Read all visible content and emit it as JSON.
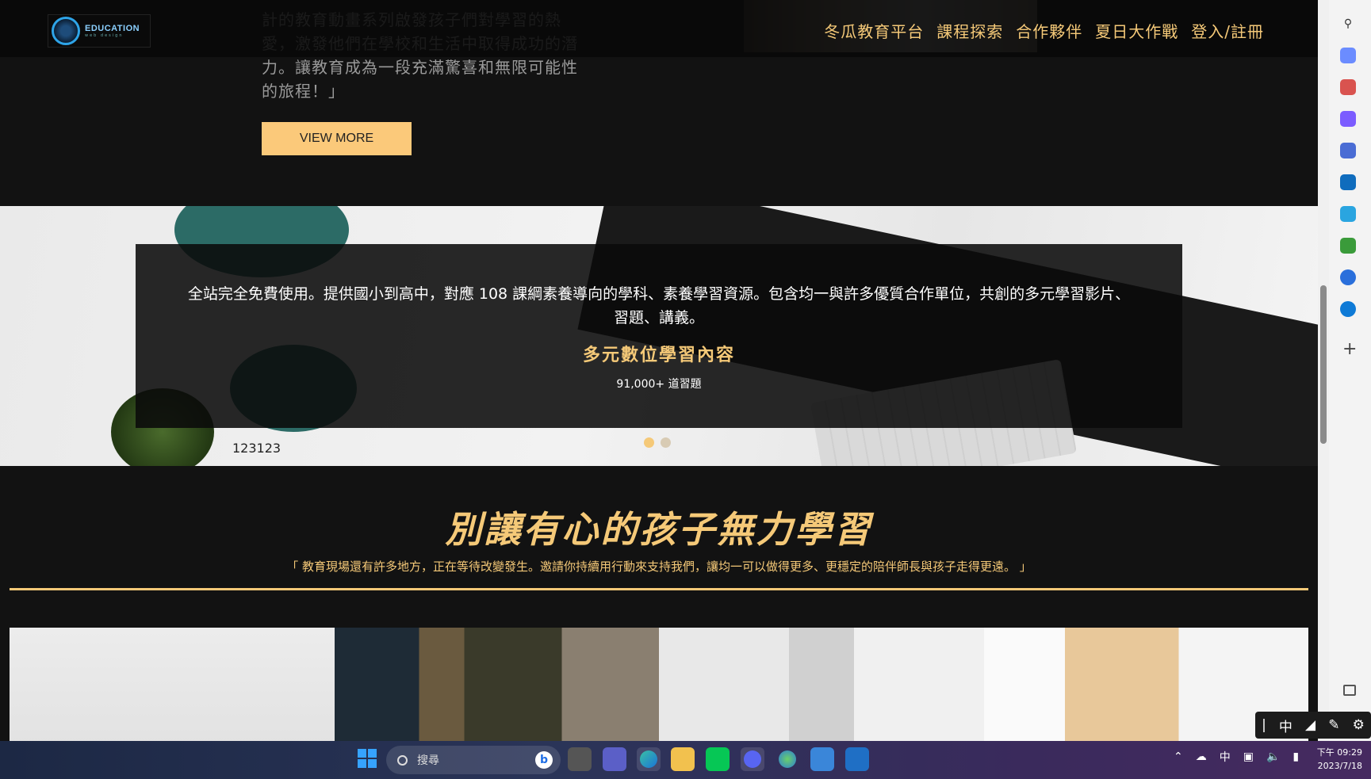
{
  "hero": {
    "text": "計的教育動畫系列啟發孩子們對學習的熱愛，激發他們在學校和生活中取得成功的潛力。讓教育成為一段充滿驚喜和無限可能性的旅程！」",
    "button": "VIEW MORE"
  },
  "header": {
    "logo_title": "EDUCATION",
    "logo_sub": "web design",
    "nav": [
      "冬瓜教育平台",
      "課程探索",
      "合作夥伴",
      "夏日大作戰",
      "登入/註冊"
    ]
  },
  "banner": {
    "description": "全站完全免費使用。提供國小到高中，對應 108 課綱素養導向的學科、素養學習資源。包含均一與許多優質合作單位，共創的多元學習影片、習題、講義。",
    "title": "多元數位學習內容",
    "count": "91,000+ 道習題",
    "caption": "123123",
    "active_slide": 1,
    "slides_total": 2
  },
  "mission": {
    "title": "別讓有心的孩子無力學習",
    "subtitle": "「 教育現場還有許多地方，正在等待改變發生。邀請你持續用行動來支持我們，讓均一可以做得更多、更穩定的陪伴師長與孩子走得更遠。 」"
  },
  "ime": {
    "mode": "中"
  },
  "taskbar": {
    "search_placeholder": "搜尋",
    "bing": "b",
    "tray_lang": "中",
    "time": "下午 09:29",
    "date": "2023/7/18"
  },
  "colors": {
    "accent": "#f5c978",
    "button": "#fbc97a",
    "background": "#121212"
  }
}
